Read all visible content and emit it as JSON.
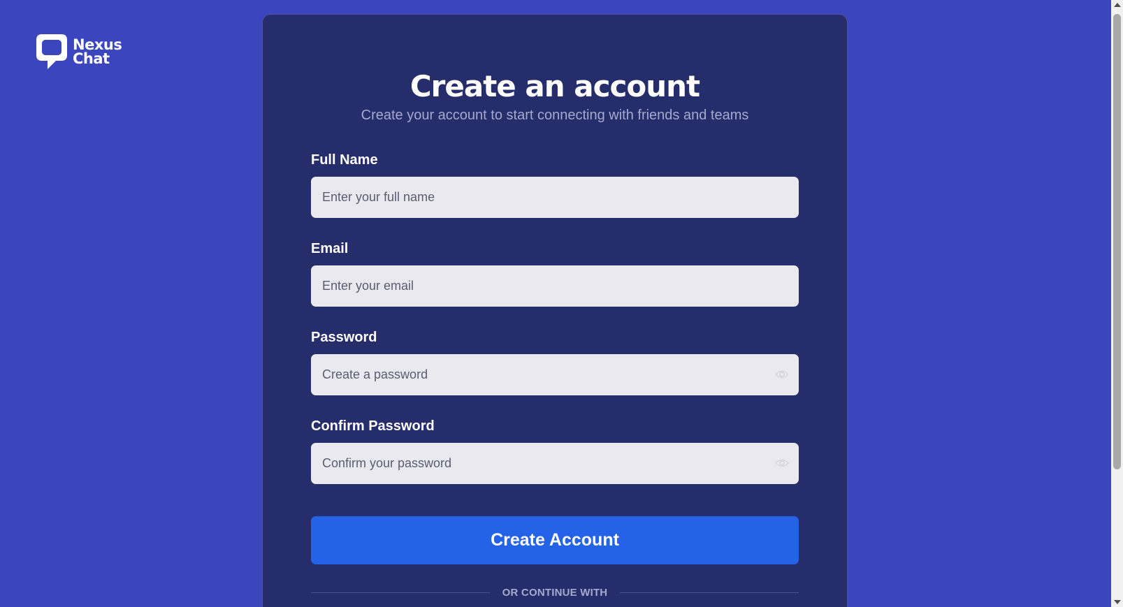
{
  "brand": {
    "name_line1": "Nexus",
    "name_line2": "Chat"
  },
  "form": {
    "title": "Create an account",
    "subtitle": "Create your account to start connecting with friends and teams",
    "fields": [
      {
        "label": "Full Name",
        "placeholder": "Enter your full name",
        "type": "text",
        "value": ""
      },
      {
        "label": "Email",
        "placeholder": "Enter your email",
        "type": "email",
        "value": ""
      },
      {
        "label": "Password",
        "placeholder": "Create a password",
        "type": "password",
        "value": "",
        "icon": "eye-icon"
      },
      {
        "label": "Confirm Password",
        "placeholder": "Confirm your password",
        "type": "password",
        "value": "",
        "icon": "eye-icon"
      }
    ],
    "submit_label": "Create Account",
    "divider_text": "OR CONTINUE WITH"
  },
  "colors": {
    "page_background": "#3a45be",
    "card_background": "#262d6b",
    "input_background": "#ebe9f0",
    "primary_button": "#2463e8",
    "subtitle_text": "#a3a9cf"
  }
}
